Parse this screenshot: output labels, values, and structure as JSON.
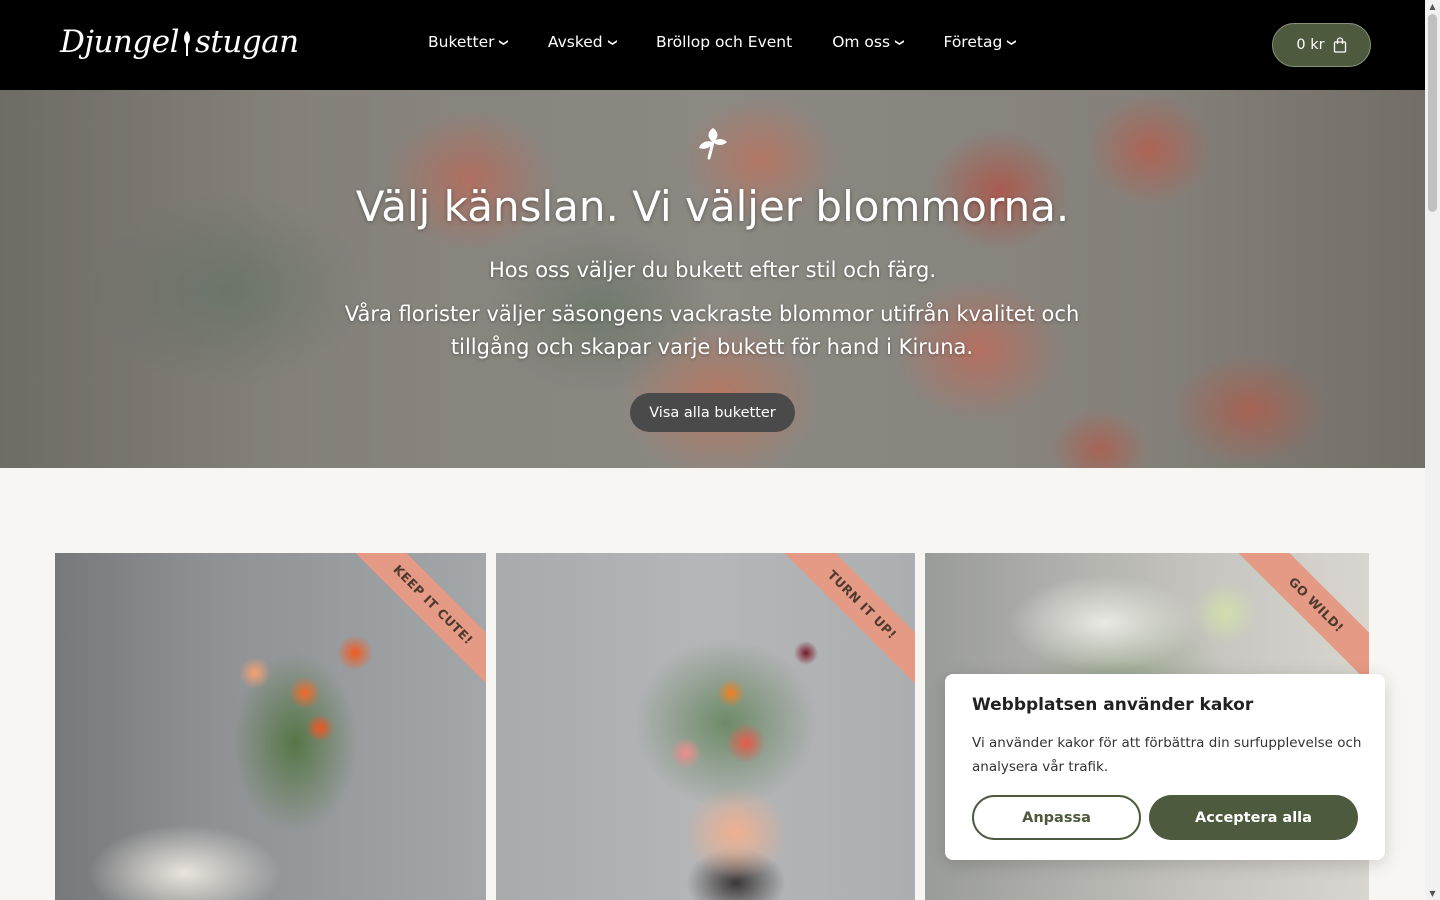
{
  "header": {
    "logo_left": "Djungel",
    "logo_right": "stugan",
    "nav": [
      {
        "label": "Buketter",
        "dropdown": true
      },
      {
        "label": "Avsked",
        "dropdown": true
      },
      {
        "label": "Bröllop och Event",
        "dropdown": false
      },
      {
        "label": "Om oss",
        "dropdown": true
      },
      {
        "label": "Företag",
        "dropdown": true
      }
    ],
    "cart_label": "0 kr"
  },
  "hero": {
    "title": "Välj känslan. Vi väljer blommorna.",
    "subtitle": "Hos oss väljer du bukett efter stil och färg.",
    "paragraph": "Våra florister väljer säsongens vackraste blommor utifrån kvalitet och tillgång och skapar varje bukett för hand i Kiruna.",
    "button": "Visa alla buketter"
  },
  "cards": [
    {
      "ribbon": "KEEP IT CUTE!"
    },
    {
      "ribbon": "TURN IT UP!"
    },
    {
      "ribbon": "GO WILD!"
    }
  ],
  "cookie": {
    "title": "Webbplatsen använder kakor",
    "text": "Vi använder kakor för att förbättra din surfupplevelse och analysera vår trafik.",
    "customize": "Anpassa",
    "accept": "Acceptera alla"
  },
  "colors": {
    "brand_green": "#4d5a3d",
    "ribbon": "#e49a84",
    "header_bg": "#000000",
    "page_bg": "#f7f6f2"
  },
  "icons": {
    "chevron": "chevron-down-icon",
    "cart": "shopping-bag-icon",
    "hero": "flower-logo-icon"
  }
}
